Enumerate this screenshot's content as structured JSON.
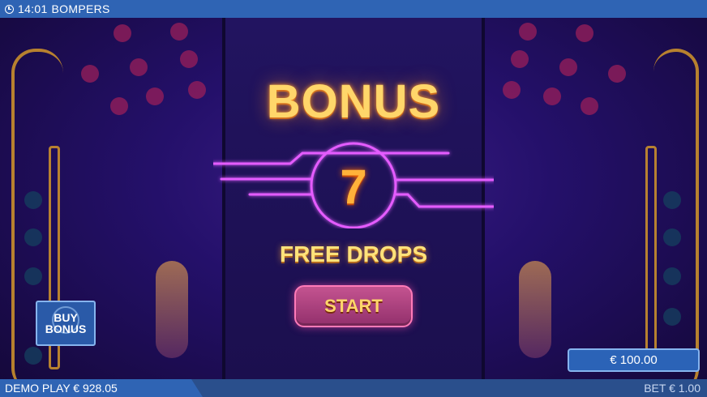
{
  "topbar": {
    "time": "14:01",
    "game_name": "BOMPERS"
  },
  "bonus": {
    "title": "BONUS",
    "count": "7",
    "subtitle": "FREE DROPS",
    "start_label": "START"
  },
  "buy_bonus": {
    "line1": "BUY",
    "line2": "BONUS"
  },
  "balance": "€ 100.00",
  "bottombar": {
    "demo_label": "DEMO PLAY € 928.05",
    "bet_label": "BET € 1.00"
  },
  "colors": {
    "topbar": "#2f64b4",
    "neon": "#e45bff",
    "title": "#ffd66a",
    "button": "#b0447f"
  },
  "icons": {
    "clock": "clock-icon",
    "buy_bonus": "buy-bonus-icon"
  }
}
